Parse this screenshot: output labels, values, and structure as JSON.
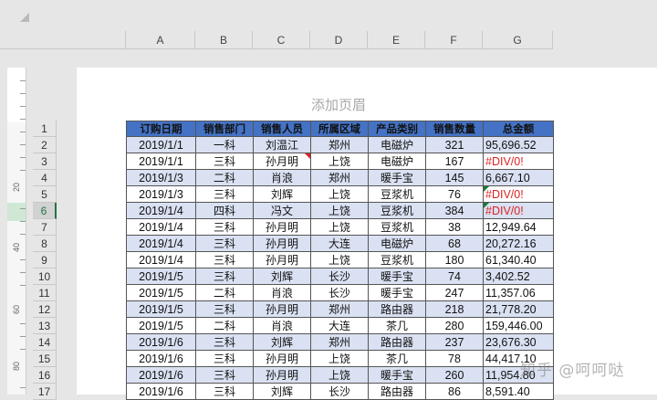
{
  "columns": [
    "A",
    "B",
    "C",
    "D",
    "E",
    "F",
    "G"
  ],
  "page_header_placeholder": "添加页眉",
  "ruler_labels": [
    "20",
    "40",
    "60",
    "80"
  ],
  "row_numbers": [
    "1",
    "2",
    "3",
    "4",
    "5",
    "6",
    "7",
    "8",
    "9",
    "10",
    "11",
    "12",
    "13",
    "14",
    "15",
    "16",
    "17"
  ],
  "active_row": "6",
  "table": {
    "headers": [
      "订购日期",
      "销售部门",
      "销售人员",
      "所属区域",
      "产品类别",
      "销售数量",
      "总金额"
    ],
    "rows": [
      [
        "2019/1/1",
        "一科",
        "刘温江",
        "郑州",
        "电磁炉",
        "321",
        "95,696.52"
      ],
      [
        "2019/1/1",
        "三科",
        "孙月明",
        "上饶",
        "电磁炉",
        "167",
        "#DIV/0!"
      ],
      [
        "2019/1/3",
        "二科",
        "肖浪",
        "郑州",
        "暖手宝",
        "145",
        "6,667.10"
      ],
      [
        "2019/1/3",
        "三科",
        "刘辉",
        "上饶",
        "豆浆机",
        "76",
        "#DIV/0!"
      ],
      [
        "2019/1/4",
        "四科",
        "冯文",
        "上饶",
        "豆浆机",
        "384",
        "#DIV/0!"
      ],
      [
        "2019/1/4",
        "三科",
        "孙月明",
        "上饶",
        "豆浆机",
        "38",
        "12,949.64"
      ],
      [
        "2019/1/4",
        "三科",
        "孙月明",
        "大连",
        "电磁炉",
        "68",
        "20,272.16"
      ],
      [
        "2019/1/4",
        "三科",
        "孙月明",
        "上饶",
        "豆浆机",
        "180",
        "61,340.40"
      ],
      [
        "2019/1/5",
        "三科",
        "刘辉",
        "长沙",
        "暖手宝",
        "74",
        "3,402.52"
      ],
      [
        "2019/1/5",
        "二科",
        "肖浪",
        "长沙",
        "暖手宝",
        "247",
        "11,357.06"
      ],
      [
        "2019/1/5",
        "三科",
        "孙月明",
        "郑州",
        "路由器",
        "218",
        "21,778.20"
      ],
      [
        "2019/1/5",
        "二科",
        "肖浪",
        "大连",
        "茶几",
        "280",
        "159,446.00"
      ],
      [
        "2019/1/6",
        "三科",
        "刘辉",
        "郑州",
        "路由器",
        "237",
        "23,676.30"
      ],
      [
        "2019/1/6",
        "三科",
        "孙月明",
        "上饶",
        "茶几",
        "78",
        "44,417.10"
      ],
      [
        "2019/1/6",
        "三科",
        "孙月明",
        "上饶",
        "暖手宝",
        "260",
        "11,954.80"
      ],
      [
        "2019/1/6",
        "三科",
        "刘辉",
        "长沙",
        "路由器",
        "86",
        "8,591.40"
      ]
    ]
  },
  "watermark": "知乎 @呵呵哒",
  "colors": {
    "header_fill": "#4472c4",
    "band_fill": "#d9e1f2",
    "error_text": "#dd2222",
    "active_row": "#217346"
  }
}
